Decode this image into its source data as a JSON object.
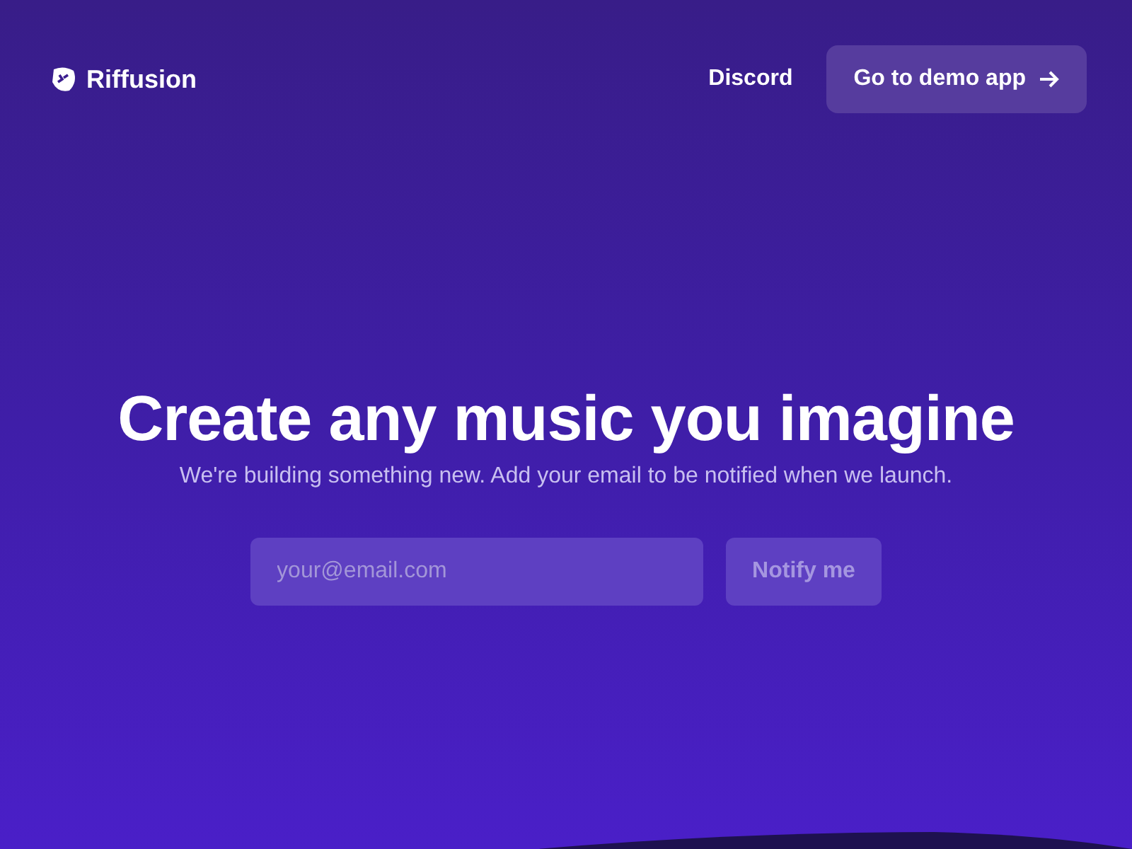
{
  "header": {
    "brand": "Riffusion",
    "links": [
      {
        "label": "Discord",
        "kind": "link"
      },
      {
        "label": "Go to demo app",
        "kind": "button"
      }
    ]
  },
  "hero": {
    "title": "Create any music you imagine",
    "subtitle": "We're building something new. Add your email to be notified when we launch."
  },
  "signup": {
    "placeholder": "your@email.com",
    "button": {
      "label": "Notify me",
      "disabled": true
    }
  }
}
